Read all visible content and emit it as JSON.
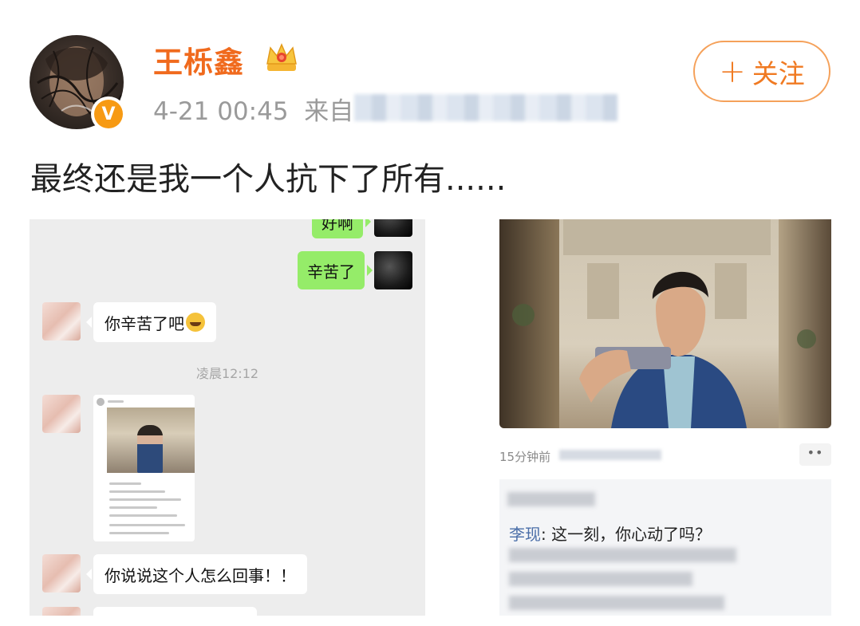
{
  "post": {
    "username": "王栎鑫",
    "timestamp": "4-21 00:45",
    "source_prefix": "来自",
    "follow_plus": "+",
    "follow_label": "关注",
    "text": "最终还是我一个人抗下了所有......"
  },
  "chat": {
    "messages": {
      "top_partial": "好啊",
      "sent": "辛苦了",
      "reply": "你辛苦了吧",
      "time": "凌晨12:12",
      "question": "你说说这个人怎么回事！！"
    }
  },
  "embedded_post": {
    "time": "15分钟前",
    "more_label": "••",
    "comment_author": "李现",
    "comment_text": ": 这一刻，你心动了吗？"
  },
  "colors": {
    "username": "#f06a1d",
    "follow_border": "#f5a15a",
    "chat_bg": "#ededed",
    "sent_bubble": "#95ec69",
    "verified_badge": "#f79a13"
  },
  "icons": {
    "verified": "verified-v-icon",
    "crown": "crown-icon",
    "more": "more-dots-icon"
  }
}
